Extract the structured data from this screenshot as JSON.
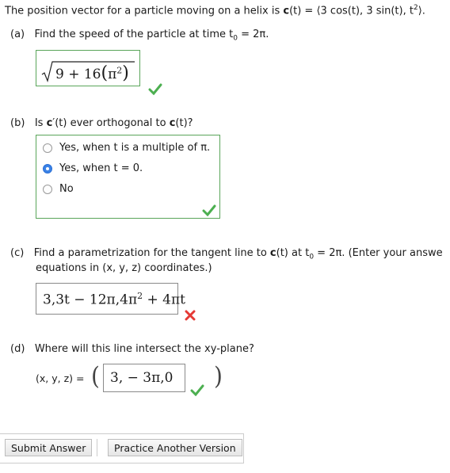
{
  "header": {
    "prefix": "The position vector for a particle moving on a helix is ",
    "r_var": "c",
    "mid": "(t) = ⟨3 cos(t), 3 sin(t), t",
    "sup": "2",
    "suffix": "⟩."
  },
  "part_a": {
    "label": "(a)",
    "prompt": "Find the speed of the particle at time t",
    "sub": "0",
    "prompt_tail": " = 2π.",
    "answer_pre": "9 + 16",
    "answer_inner": "π",
    "answer_sup": "2",
    "status": "correct"
  },
  "part_b": {
    "label": "(b)",
    "prompt_pre": "Is ",
    "prompt_bold": "c",
    "prompt_mid": "′(t) ever orthogonal to ",
    "prompt_bold2": "c",
    "prompt_tail": "(t)?",
    "options": [
      {
        "label": "Yes, when t is a multiple of π.",
        "selected": false
      },
      {
        "label": "Yes, when t = 0.",
        "selected": true
      },
      {
        "label": "No",
        "selected": false
      }
    ],
    "status": "correct"
  },
  "part_c": {
    "label": "(c)",
    "prompt_line1_pre": "Find a parametrization for the tangent line to ",
    "prompt_bold": "c",
    "prompt_line1_mid": "(t) at t",
    "sub": "0",
    "prompt_line1_tail": " = 2π. (Enter your answe",
    "prompt_line2": "equations in (x, y, z) coordinates.)",
    "answer_pre": "3,3t − 12π,4π",
    "answer_sup": "2",
    "answer_tail": " + 4πt",
    "status": "incorrect"
  },
  "part_d": {
    "label": "(d)",
    "prompt": "Where will this line intersect the xy-plane?",
    "coord_label": "(x, y, z) =",
    "answer": "3, − 3π,0",
    "status": "correct"
  },
  "buttons": {
    "submit": "Submit Answer",
    "practice": "Practice Another Version"
  },
  "colors": {
    "correct": "#4caf50",
    "incorrect": "#e53935",
    "box_border": "#5aa55a"
  }
}
